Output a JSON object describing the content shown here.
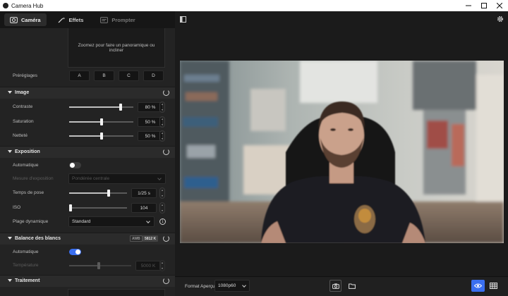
{
  "window": {
    "title": "Camera Hub"
  },
  "tabs": [
    {
      "label": "Caméra",
      "state": "active"
    },
    {
      "label": "Effets",
      "state": "normal"
    },
    {
      "label": "Prompter",
      "state": "disabled"
    }
  ],
  "zoom_hint": "Zoomez pour faire un panoramique ou incliner",
  "presets": {
    "label": "Préréglages",
    "buttons": [
      "A",
      "B",
      "C",
      "D"
    ]
  },
  "image_section": {
    "title": "Image",
    "sliders": [
      {
        "label": "Contraste",
        "value_text": "80 %",
        "level": 0.8
      },
      {
        "label": "Saturation",
        "value_text": "50 %",
        "level": 0.5
      },
      {
        "label": "Netteté",
        "value_text": "50 %",
        "level": 0.5
      }
    ]
  },
  "exposure_section": {
    "title": "Exposition",
    "auto_label": "Automatique",
    "auto_on": false,
    "metering_label": "Mesure d'exposition",
    "metering_value": "Pondérée centrale",
    "shutter_label": "Temps de pose",
    "shutter_value": "1/25 s",
    "shutter_level": 0.68,
    "iso_label": "ISO",
    "iso_value": "104",
    "iso_level": 0.0,
    "dynamic_label": "Plage dynamique",
    "dynamic_value": "Standard",
    "info_glyph": "i"
  },
  "wb_section": {
    "title": "Balance des blancs",
    "badge_awb": "AWB",
    "badge_value": "5812 K",
    "auto_label": "Automatique",
    "auto_on": true,
    "temp_label": "Température",
    "temp_value": "5000 K",
    "temp_level": 0.48
  },
  "processing_section": {
    "title": "Traitement"
  },
  "bottom": {
    "format_label": "Format Aperçu",
    "format_value": "1080p60"
  },
  "colors": {
    "accent": "#3a6ff0",
    "toggle_off": "#3c3c3c",
    "panel": "#232323",
    "section_header": "#2b2b2b"
  },
  "icons": [
    "camera-icon",
    "magic-wand-icon",
    "prompter-icon",
    "sidebar-toggle-icon",
    "gear-icon",
    "reset-icon",
    "snapshot-icon",
    "folder-icon",
    "eye-icon",
    "grid-icon",
    "info-icon"
  ]
}
